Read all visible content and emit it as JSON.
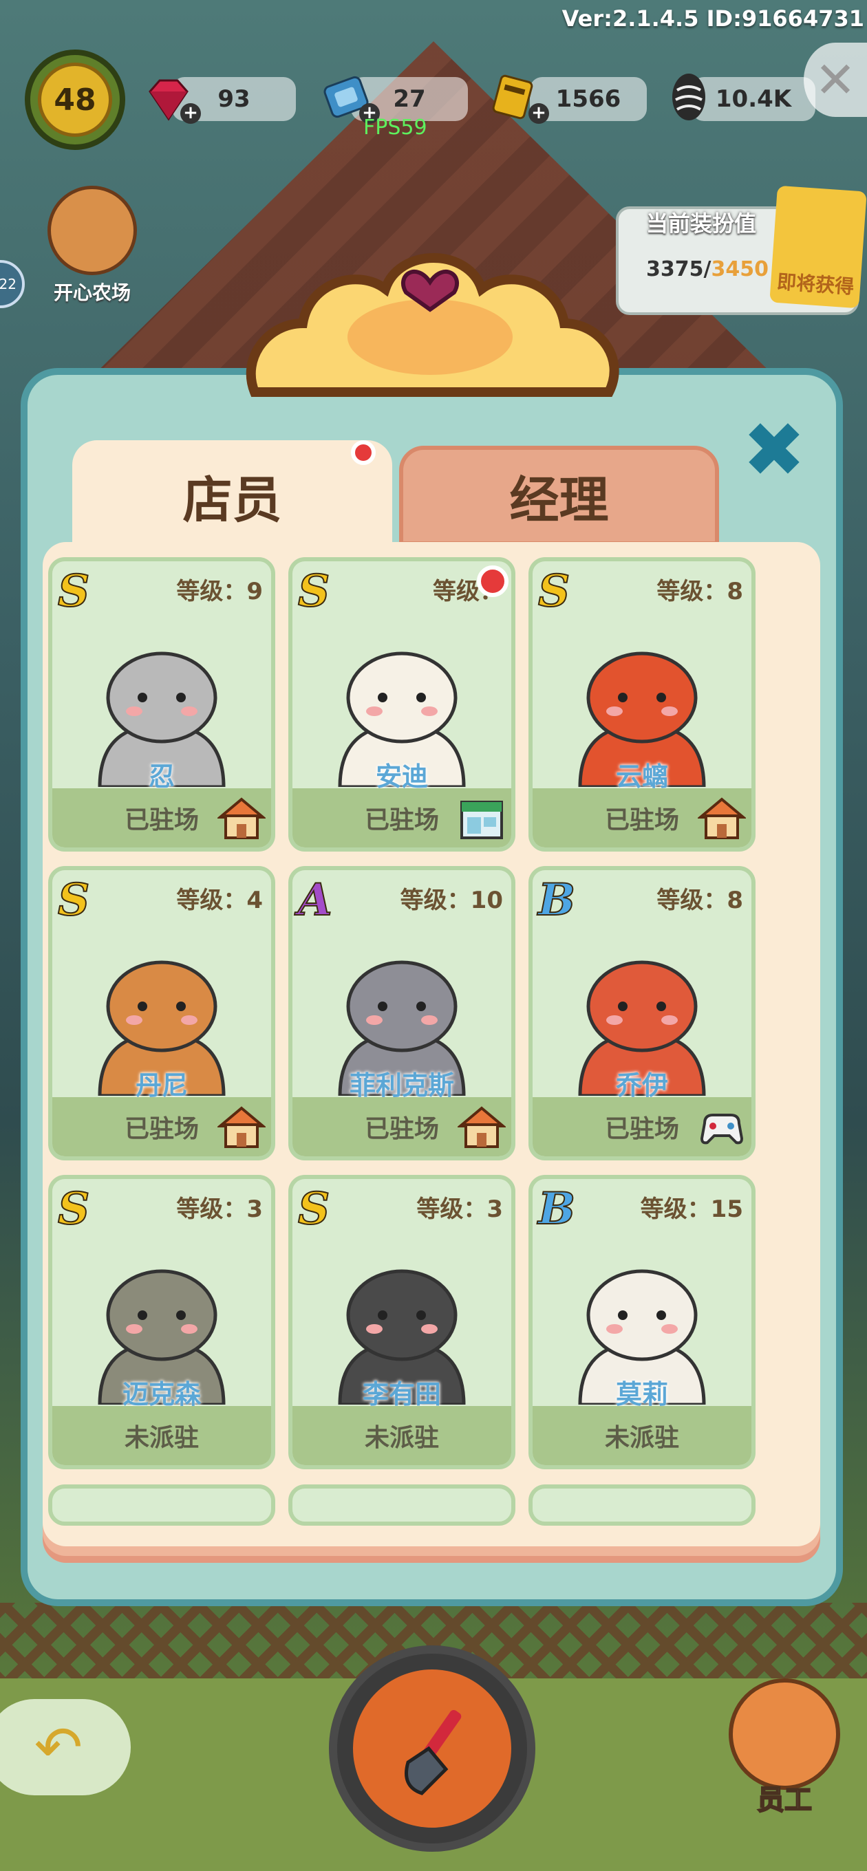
{
  "hud": {
    "version": "Ver:2.1.4.5 ID:91664731",
    "level": "48",
    "fps": "FPS59",
    "resources": [
      {
        "name": "gems",
        "value": "93",
        "color": "#d6254a",
        "icon": "gem-icon"
      },
      {
        "name": "tickets",
        "value": "27",
        "color": "#3f8fc7",
        "icon": "ticket-icon"
      },
      {
        "name": "coupons",
        "value": "1566",
        "color": "#e7b21c",
        "icon": "coupon-icon"
      },
      {
        "name": "seeds",
        "value": "10.4K",
        "color": "#333333",
        "icon": "sunflower-seed-icon"
      }
    ]
  },
  "sidebar": {
    "farm_label": "开心农场",
    "circle_value": "22"
  },
  "outfit": {
    "title": "当前装扮值",
    "current": "3375",
    "separator": "/",
    "max": "3450",
    "soon_label": "即将获得"
  },
  "tabs": [
    {
      "label": "店员",
      "active": true,
      "badge": true
    },
    {
      "label": "经理",
      "active": false,
      "badge": false
    }
  ],
  "level_prefix": "等级：",
  "staff": [
    {
      "name": "忍",
      "rank": "S",
      "level": "9",
      "status": "已驻场",
      "place": "house-icon",
      "dot": false
    },
    {
      "name": "安迪",
      "rank": "S",
      "level": "",
      "status": "已驻场",
      "place": "shop-icon",
      "dot": true
    },
    {
      "name": "云螭",
      "rank": "S",
      "level": "8",
      "status": "已驻场",
      "place": "house-icon",
      "dot": false
    },
    {
      "name": "丹尼",
      "rank": "S",
      "level": "4",
      "status": "已驻场",
      "place": "house-icon",
      "dot": false
    },
    {
      "name": "菲利克斯",
      "rank": "A",
      "level": "10",
      "status": "已驻场",
      "place": "house-icon",
      "dot": false
    },
    {
      "name": "乔伊",
      "rank": "B",
      "level": "8",
      "status": "已驻场",
      "place": "gamepad-icon",
      "dot": false
    },
    {
      "name": "迈克森",
      "rank": "S",
      "level": "3",
      "status": "未派驻",
      "place": "",
      "dot": false
    },
    {
      "name": "李有田",
      "rank": "S",
      "level": "3",
      "status": "未派驻",
      "place": "",
      "dot": false
    },
    {
      "name": "莫莉",
      "rank": "B",
      "level": "15",
      "status": "未派驻",
      "place": "",
      "dot": false
    }
  ],
  "rank_colors": {
    "S": "#f3c21c",
    "A": "#a34cc9",
    "B": "#4ea6e4"
  },
  "bottom": {
    "staff_label": "员工"
  }
}
